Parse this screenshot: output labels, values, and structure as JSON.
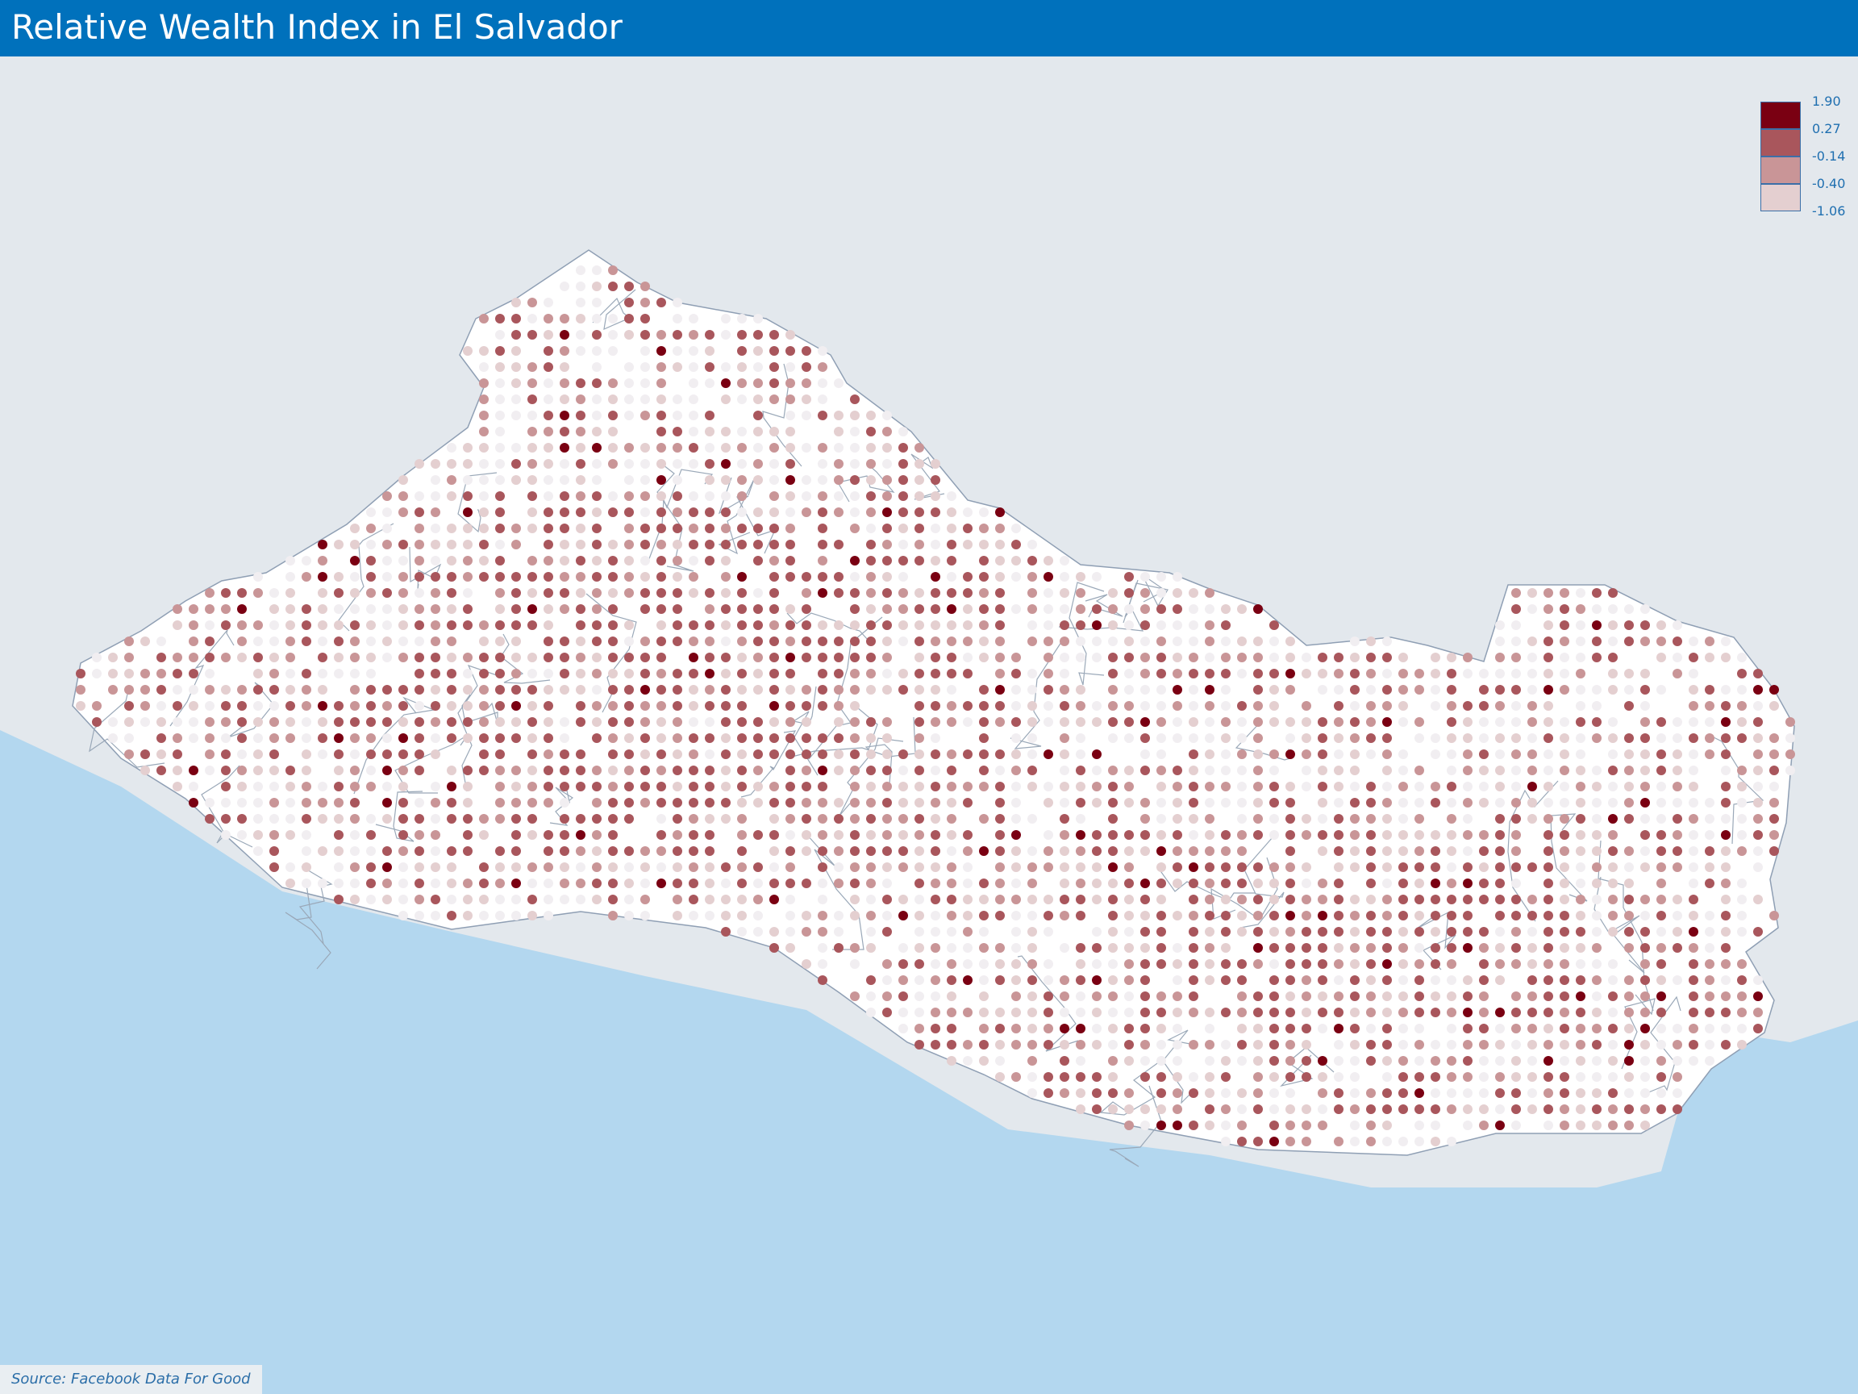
{
  "header": {
    "title": "Relative Wealth Index in El Salvador"
  },
  "legend": {
    "items": [
      {
        "label": "1.90",
        "color": "#7a0012"
      },
      {
        "label": "0.27",
        "color": "#a9565c"
      },
      {
        "label": "-0.14",
        "color": "#c99597"
      },
      {
        "label": "-0.40",
        "color": "#e4cfd0"
      },
      {
        "label": "-1.06",
        "color": ""
      }
    ]
  },
  "map": {
    "sea_color": "#b3d7ef",
    "land_color": "#ffffff",
    "neighbor_color": "#e3e8ed",
    "border_color": "#8f9fb4",
    "dot_colors": [
      "#f1eef1",
      "#e4cfd0",
      "#c99597",
      "#a9565c",
      "#7a0012"
    ]
  },
  "footer": {
    "source": "Source: Facebook Data For Good"
  }
}
